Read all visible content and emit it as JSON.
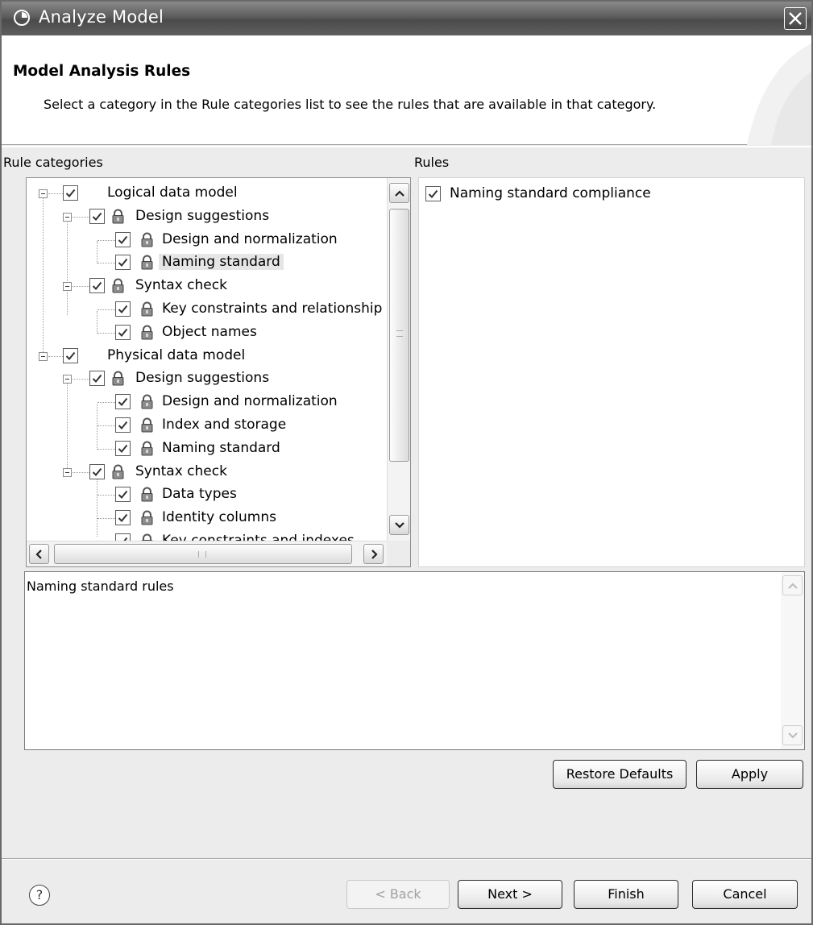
{
  "window": {
    "title": "Analyze Model"
  },
  "banner": {
    "heading": "Model Analysis Rules",
    "description": "Select a category in the Rule categories list to see the rules that are available in that category."
  },
  "labels": {
    "rule_categories": "Rule categories",
    "rules": "Rules"
  },
  "tree": {
    "items": [
      {
        "label": "Logical data model",
        "level": 0,
        "checked": true,
        "locked": false,
        "expanded": true
      },
      {
        "label": "Design suggestions",
        "level": 1,
        "checked": true,
        "locked": true,
        "expanded": true
      },
      {
        "label": "Design and normalization",
        "level": 2,
        "checked": true,
        "locked": true
      },
      {
        "label": "Naming standard",
        "level": 2,
        "checked": true,
        "locked": true,
        "selected": true
      },
      {
        "label": "Syntax check",
        "level": 1,
        "checked": true,
        "locked": true,
        "expanded": true
      },
      {
        "label": "Key constraints and relationship",
        "level": 2,
        "checked": true,
        "locked": true
      },
      {
        "label": "Object names",
        "level": 2,
        "checked": true,
        "locked": true
      },
      {
        "label": "Physical data model",
        "level": 0,
        "checked": true,
        "locked": false,
        "expanded": true
      },
      {
        "label": "Design suggestions",
        "level": 1,
        "checked": true,
        "locked": true,
        "expanded": true
      },
      {
        "label": "Design and normalization",
        "level": 2,
        "checked": true,
        "locked": true
      },
      {
        "label": "Index and storage",
        "level": 2,
        "checked": true,
        "locked": true
      },
      {
        "label": "Naming standard",
        "level": 2,
        "checked": true,
        "locked": true
      },
      {
        "label": "Syntax check",
        "level": 1,
        "checked": true,
        "locked": true,
        "expanded": true
      },
      {
        "label": "Data types",
        "level": 2,
        "checked": true,
        "locked": true
      },
      {
        "label": "Identity columns",
        "level": 2,
        "checked": true,
        "locked": true
      },
      {
        "label": "Key constraints and indexes",
        "level": 2,
        "checked": true,
        "locked": true
      }
    ]
  },
  "rules": [
    {
      "label": "Naming standard compliance",
      "checked": true
    }
  ],
  "description_panel": {
    "text": "Naming standard rules"
  },
  "buttons": {
    "restore_defaults": "Restore Defaults",
    "apply": "Apply",
    "back": "< Back",
    "next": "Next >",
    "finish": "Finish",
    "cancel": "Cancel",
    "help": "?"
  },
  "icons": {
    "app": "analyze-icon",
    "close": "close-icon",
    "lock": "lock-icon",
    "check": "checkmark-icon",
    "help": "help-icon"
  }
}
